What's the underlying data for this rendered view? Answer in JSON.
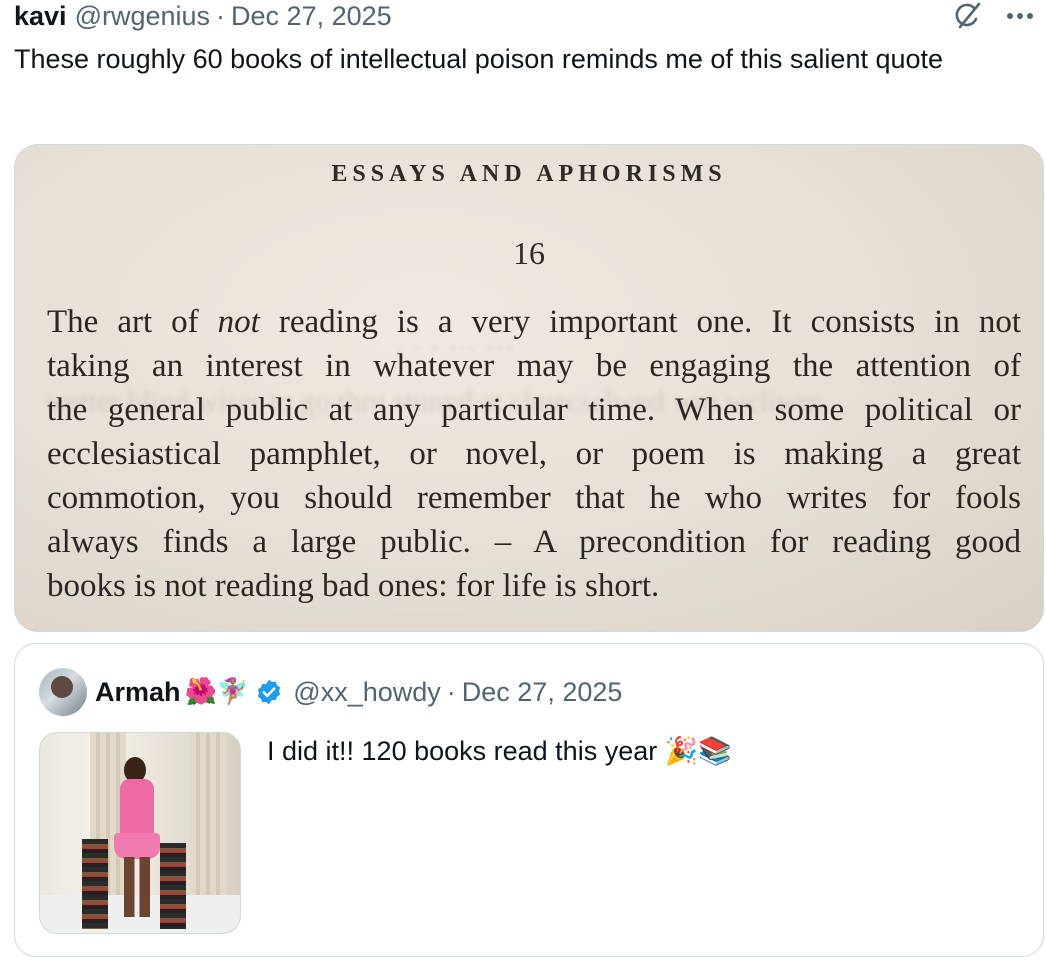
{
  "tweet": {
    "author_name": "kavi",
    "author_handle": "@rwgenius",
    "separator": "·",
    "date": "Dec 27, 2025",
    "text": "These roughly 60 books of intellectual poison reminds me of this salient quote",
    "icons": [
      "grok-icon",
      "more-icon"
    ]
  },
  "media": {
    "page_header": "ESSAYS AND APHORISMS",
    "page_number": "16",
    "lines": [
      "The art of not reading is a very important one. It consists in not",
      "taking an interest in whatever may be engaging the attention of",
      "the general public at any particular time. When some political or",
      "ecclesiastical pamphlet, or novel, or poem is making a great",
      "commotion, you should remember that he who writes for fools",
      "always finds a large public. – A precondition for reading good",
      "books is not reading bad ones: for life is short."
    ]
  },
  "quoted": {
    "author_name": "Armah",
    "name_emojis": "🌺🧚🏽‍♀️",
    "author_handle": "@xx_howdy",
    "separator": "·",
    "date": "Dec 27, 2025",
    "text": "I did it!! 120 books read this year 🎉📚",
    "verified_color": "#1d9bf0"
  }
}
